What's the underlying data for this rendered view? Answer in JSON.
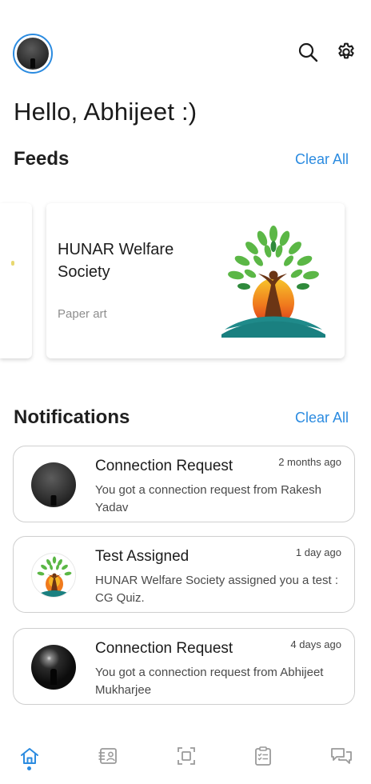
{
  "header": {
    "greeting": "Hello, Abhijeet :)"
  },
  "feeds": {
    "title": "Feeds",
    "clear_label": "Clear All",
    "items": [
      {
        "name": "HUNAR Welfare Society",
        "category": "Paper art"
      }
    ]
  },
  "notifications": {
    "title": "Notifications",
    "clear_label": "Clear All",
    "items": [
      {
        "heading": "Connection Request",
        "time": "2 months ago",
        "body": "You got a connection request from Rakesh Yadav"
      },
      {
        "heading": "Test Assigned",
        "time": "1 day ago",
        "body": "HUNAR Welfare Society assigned you a test : CG Quiz."
      },
      {
        "heading": "Connection Request",
        "time": "4 days ago",
        "body": "You got a connection request from Abhijeet Mukharjee"
      }
    ]
  },
  "icons": {
    "search": "search-icon",
    "settings": "gear-icon",
    "nav": [
      "home-icon",
      "profile-list-icon",
      "scan-icon",
      "checklist-icon",
      "chat-icon"
    ]
  },
  "colors": {
    "accent": "#2b8be0",
    "nav_inactive": "#9a9a9a"
  }
}
